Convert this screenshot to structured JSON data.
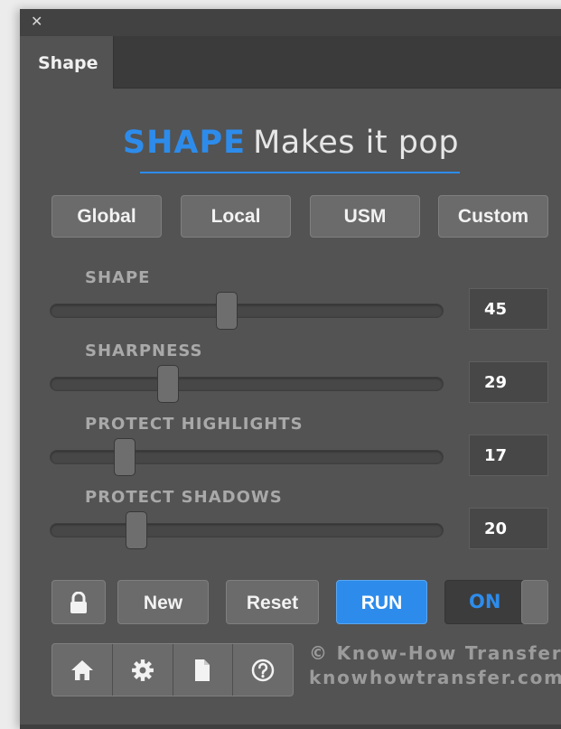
{
  "window": {
    "close_icon": "close-icon",
    "collapse_icon": "double-chevron-icon"
  },
  "tab": {
    "label": "Shape",
    "menu_icon": "hamburger-menu-icon"
  },
  "header": {
    "brand": "SHAPE",
    "tagline": "Makes it pop"
  },
  "presets": [
    "Global",
    "Local",
    "USM",
    "Custom"
  ],
  "sliders": [
    {
      "label": "SHAPE",
      "value": "45",
      "position_fraction": 0.45
    },
    {
      "label": "SHARPNESS",
      "value": "29",
      "position_fraction": 0.3
    },
    {
      "label": "PROTECT HIGHLIGHTS",
      "value": "17",
      "position_fraction": 0.19
    },
    {
      "label": "PROTECT SHADOWS",
      "value": "20",
      "position_fraction": 0.22
    }
  ],
  "actions": {
    "new_label": "New",
    "reset_label": "Reset",
    "run_label": "RUN",
    "toggle_label": "ON",
    "toggle_state": true
  },
  "icons": [
    "home-icon",
    "gear-icon",
    "document-icon",
    "help-icon",
    "lock-icon"
  ],
  "credits": {
    "line1": "© Know-How Transfer",
    "line2": "knowhowtransfer.com"
  },
  "colors": {
    "accent": "#2d8ceb",
    "panel": "#535353",
    "button": "#6b6b6b"
  }
}
